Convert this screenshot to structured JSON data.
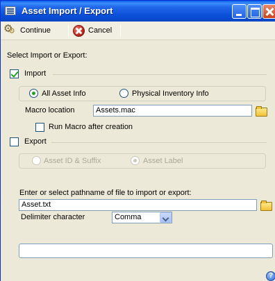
{
  "window": {
    "title": "Asset Import / Export",
    "controls": {
      "minimize": "minimize",
      "maximize": "maximize",
      "close": "close"
    }
  },
  "toolbar": {
    "continue_label": "Continue",
    "cancel_label": "Cancel"
  },
  "form": {
    "prompt": "Select Import or Export:",
    "import": {
      "label": "Import",
      "checked": true,
      "options": [
        {
          "label": "All Asset Info",
          "selected": true
        },
        {
          "label": "Physical Inventory Info",
          "selected": false
        }
      ],
      "macro_location_label": "Macro location",
      "macro_location_value": "Assets.mac",
      "run_macro_label": "Run Macro after creation",
      "run_macro_checked": false
    },
    "export": {
      "label": "Export",
      "checked": false,
      "options": [
        {
          "label": "Asset ID & Suffix",
          "selected": false
        },
        {
          "label": "Asset Label",
          "selected": true
        }
      ]
    },
    "pathname_label": "Enter or select pathname of file to import or export:",
    "pathname_value": "Asset.txt",
    "delimiter_label": "Delimiter character",
    "delimiter_value": "Comma"
  },
  "colors": {
    "titlebar": "#0a46c5",
    "window_bg": "#ece9d8",
    "check_green": "#21a121",
    "field_border": "#7f9db9"
  },
  "icons": {
    "window": "list-window-icon",
    "continue": "gears-icon",
    "cancel": "red-x-circle-icon",
    "browse": "folder-icon",
    "help": "help-icon"
  }
}
